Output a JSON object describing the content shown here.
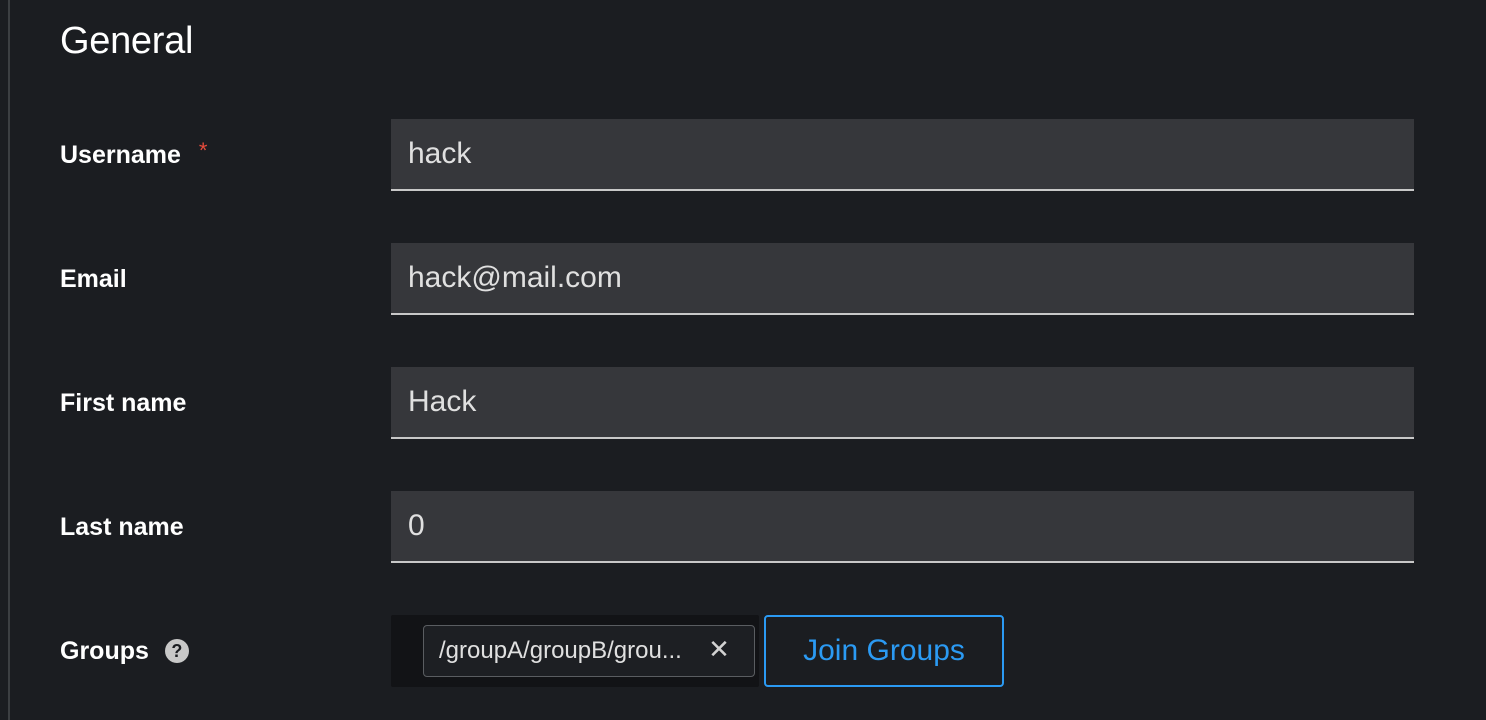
{
  "section": {
    "title": "General"
  },
  "fields": {
    "username": {
      "label": "Username",
      "required_mark": "*",
      "value": "hack"
    },
    "email": {
      "label": "Email",
      "value": "hack@mail.com"
    },
    "first_name": {
      "label": "First name",
      "value": "Hack"
    },
    "last_name": {
      "label": "Last name",
      "value": "0"
    },
    "groups": {
      "label": "Groups",
      "help_icon": "question-circle-icon",
      "chips": [
        {
          "label": "/groupA/groupB/grou..."
        }
      ],
      "chip_close_icon": "close-icon",
      "join_button_label": "Join Groups"
    }
  },
  "colors": {
    "background": "#1b1d21",
    "input_background": "#36373b",
    "accent": "#2b9af3",
    "required": "#e74c3c"
  }
}
